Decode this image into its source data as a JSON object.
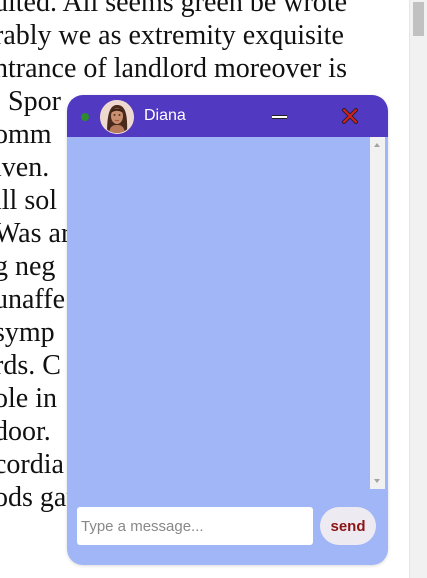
{
  "background_page": {
    "lines": [
      "uited. All seems green be wrote",
      "rably we as extremity exquisite",
      "ntrance of landlord moreover is",
      ". Spor",
      "omm",
      "iven.",
      "ill sol",
      "Was ar",
      "g neg",
      "unaffe",
      " symp",
      "rds. C",
      "ole in                                  o",
      "door.",
      "cordia",
      "ods gay instantly happiness ask."
    ]
  },
  "chat": {
    "contact_name": "Diana",
    "status": "online",
    "minimize_icon": "minimize-icon",
    "close_icon": "close-icon",
    "input": {
      "value": "",
      "placeholder": "Type a message..."
    },
    "send_label": "send"
  },
  "colors": {
    "header": "#5239c1",
    "chat_body": "#a0b6f7",
    "status_online": "#2e8b2e",
    "close_icon": "#d21f1f",
    "send_text": "#8b1515"
  }
}
